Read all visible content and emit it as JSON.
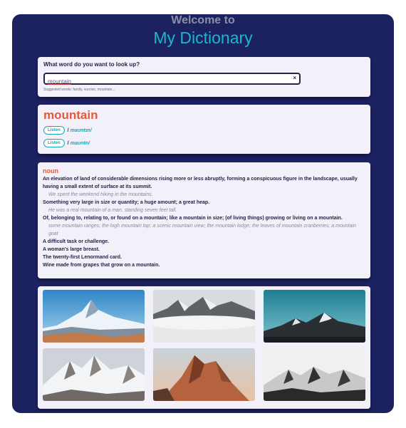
{
  "header": {
    "welcome": "Welcome to",
    "title": "My Dictionary"
  },
  "search": {
    "question": "What word do you want to look up?",
    "value": "mountain",
    "clear_label": "×",
    "suggested": "Suggested words: family, sunrise, mountain..."
  },
  "word": {
    "text": "mountain",
    "phonetics": [
      {
        "listen_label": "Listen",
        "slash": "/",
        "text": "maʊntɪn/"
      },
      {
        "listen_label": "Listen",
        "slash": "/",
        "text": "maʊntn/"
      }
    ]
  },
  "meaning": {
    "part_of_speech": "noun",
    "definitions": [
      {
        "text": "An elevation of land of considerable dimensions rising more or less abruptly, forming a conspicuous figure in the landscape, usually having a small extent of surface at its summit.",
        "example": "We spent the weekend hiking in the mountains."
      },
      {
        "text": "Something very large in size or quantity; a huge amount; a great heap.",
        "example": "He was a real mountain of a man, standing seven feet tall."
      },
      {
        "text": "Of, belonging to, relating to, or found on a mountain; like a mountain in size; (of living things) growing or living on a mountain.",
        "example": "some mountain ranges; the high mountain top; a scenic mountain view; the mountain lodge; the leaves of mountain cranberries; a mountain goat"
      },
      {
        "text": "A difficult task or challenge.",
        "example": ""
      },
      {
        "text": "A woman's large breast.",
        "example": ""
      },
      {
        "text": "The twenty-first Lenormand card.",
        "example": ""
      },
      {
        "text": "Wine made from grapes that grow on a mountain.",
        "example": ""
      }
    ]
  },
  "colors": {
    "background": "#1c2260",
    "accent_title": "#19b8c8",
    "word": "#e25a3c",
    "card": "#f2f0f8"
  }
}
